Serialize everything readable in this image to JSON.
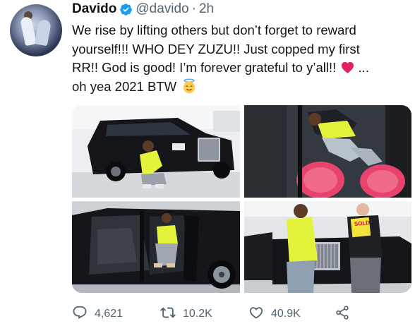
{
  "author": {
    "name": "Davido",
    "handle": "@davido",
    "separator": "·",
    "time": "2h"
  },
  "tweet": {
    "lines": [
      "We rise by lifting others but don’t forget to reward",
      "yourself!!! WHO DEY ZUZU!! Just copped my first",
      "RR!! God is good! I’m forever grateful to y’all!!",
      "oh yea 2021 BTW"
    ],
    "line3_suffix": " ...",
    "emojis": [
      "red-heart",
      "smiling-face-with-halo"
    ]
  },
  "photos": [
    {
      "name": "man-crouching-by-black-rolls-royce"
    },
    {
      "name": "man-reclining-in-car-red-sneakers"
    },
    {
      "name": "man-sitting-in-open-car-door"
    },
    {
      "name": "handover-with-sold-sign"
    }
  ],
  "sold_sign_text": "SOLD",
  "actions": {
    "replies": "4,621",
    "retweets": "10.2K",
    "likes": "40.9K"
  },
  "colors": {
    "text": "#0f1419",
    "secondary": "#536471",
    "verified_blue": "#1d9bf0",
    "heart_pink": "#e0245e"
  },
  "icons": [
    "verified-badge-icon",
    "reply-icon",
    "retweet-icon",
    "like-icon",
    "share-icon"
  ]
}
